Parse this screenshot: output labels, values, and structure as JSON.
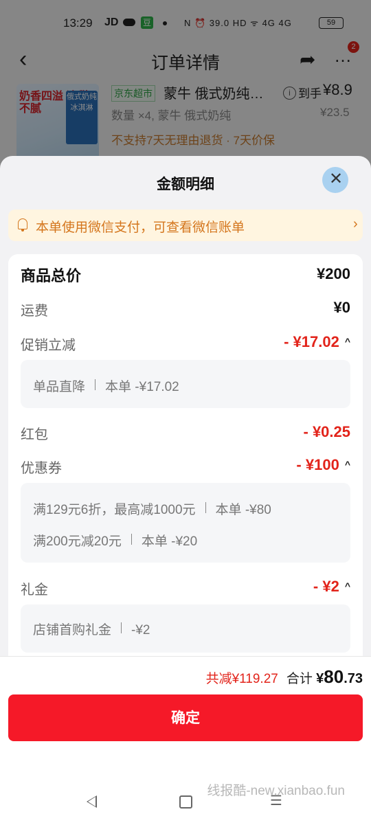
{
  "status_bar": {
    "time": "13:29",
    "carrier": "JD",
    "dou_badge": "豆",
    "net_speed": "39.0 KB/S",
    "right_text": "N ⏰ 39.0 HD ᯤ 4G 4G",
    "battery": "59"
  },
  "nav": {
    "title": "订单详情",
    "back_icon": "chevron-left",
    "share_icon": "share-arrow",
    "more_icon": "more-dots",
    "badge_count": "2"
  },
  "product": {
    "store_tag": "京东超市",
    "name": "蒙牛 俄式奶纯…",
    "daoshou_label": "到手",
    "daoshou_price": "¥8.9",
    "quantity": "数量 ×4, 蒙牛 俄式奶纯",
    "original_price": "¥23.5",
    "policy": "不支持7天无理由退货 · 7天价保",
    "thumb_text_1": "奶香四溢 清甜不腻",
    "thumb_text_2": "俄式奶纯 冰淇淋"
  },
  "sheet": {
    "title": "金额明细",
    "close_icon": "close-x"
  },
  "notice": {
    "icon": "bell",
    "text": "本单使用微信支付，可查看微信账单",
    "chevron": "›"
  },
  "breakdown": {
    "goods_total_label": "商品总价",
    "goods_total_value": "¥200",
    "shipping_label": "运费",
    "shipping_value": "¥0",
    "promo_label": "促销立减",
    "promo_value": "- ¥17.02",
    "promo_items": [
      {
        "name": "单品直降",
        "amount": "本单 -¥17.02"
      }
    ],
    "redpacket_label": "红包",
    "redpacket_value": "- ¥0.25",
    "coupon_label": "优惠券",
    "coupon_value": "- ¥100",
    "coupon_items": [
      {
        "name": "满129元6折，最高减1000元",
        "amount": "本单 -¥80"
      },
      {
        "name": "满200元减20元",
        "amount": "本单 -¥20"
      }
    ],
    "gift_label": "礼金",
    "gift_value": "- ¥2",
    "gift_items": [
      {
        "name": "店铺首购礼金",
        "amount": "-¥2"
      }
    ],
    "caret": "^"
  },
  "footer": {
    "discount_total": "共减¥119.27",
    "sum_label": "合计",
    "sum_yen": "¥",
    "sum_int": "80",
    "sum_dec": ".73",
    "confirm_label": "确定",
    "watermark": "线报酷-new.xianbao.fun"
  },
  "colors": {
    "accent_red": "#e2231a",
    "button_red": "#f51928",
    "notice_orange": "#d4761d",
    "notice_bg": "#fff5e0"
  }
}
